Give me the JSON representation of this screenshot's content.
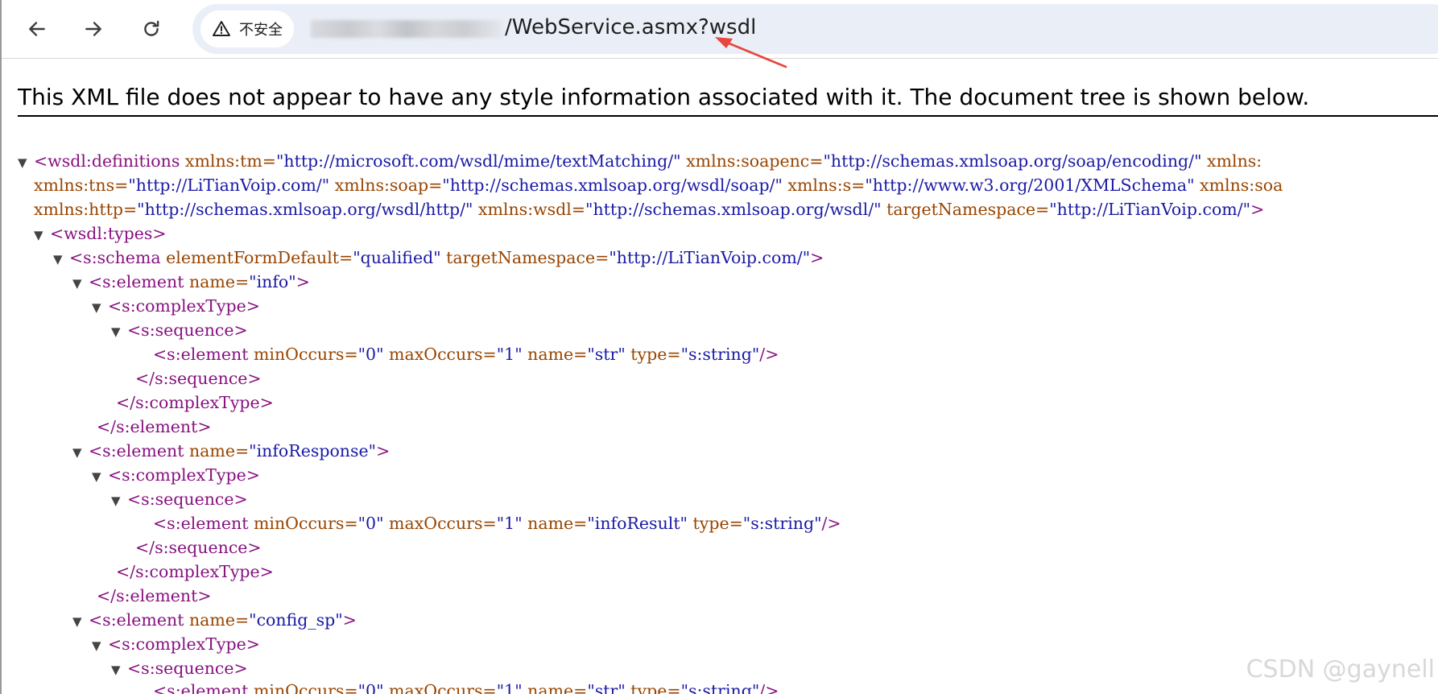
{
  "browser": {
    "security_label": "不安全",
    "url_visible": "/WebService.asmx?wsdl",
    "back_icon": "arrow-left-icon",
    "forward_icon": "arrow-right-icon",
    "reload_icon": "reload-icon",
    "warning_icon": "warning-triangle-icon",
    "arrow_color": "#e8453c"
  },
  "notice": {
    "text": "This XML file does not appear to have any style information associated with it. The document tree is shown below."
  },
  "xml": {
    "l1_tag": "<wsdl:definitions",
    "l1_a1n": " xmlns:tm=",
    "l1_a1v": "\"http://microsoft.com/wsdl/mime/textMatching/\"",
    "l1_a2n": " xmlns:soapenc=",
    "l1_a2v": "\"http://schemas.xmlsoap.org/soap/encoding/\"",
    "l1_a3n": " xmlns:",
    "l2_a1n": "xmlns:tns=",
    "l2_a1v": "\"http://LiTianVoip.com/\"",
    "l2_a2n": " xmlns:soap=",
    "l2_a2v": "\"http://schemas.xmlsoap.org/wsdl/soap/\"",
    "l2_a3n": " xmlns:s=",
    "l2_a3v": "\"http://www.w3.org/2001/XMLSchema\"",
    "l2_a4n": " xmlns:soa",
    "l3_a1n": "xmlns:http=",
    "l3_a1v": "\"http://schemas.xmlsoap.org/wsdl/http/\"",
    "l3_a2n": " xmlns:wsdl=",
    "l3_a2v": "\"http://schemas.xmlsoap.org/wsdl/\"",
    "l3_a3n": " targetNamespace=",
    "l3_a3v": "\"http://LiTianVoip.com/\"",
    "l3_close": ">",
    "l4_tag": "<wsdl:types>",
    "l5_tag": "<s:schema",
    "l5_a1n": " elementFormDefault=",
    "l5_a1v": "\"qualified\"",
    "l5_a2n": " targetNamespace=",
    "l5_a2v": "\"http://LiTianVoip.com/\"",
    "l5_close": ">",
    "el_open": "<s:element",
    "name_attr": " name=",
    "close_gt": ">",
    "ct_open": "<s:complexType>",
    "seq_open": "<s:sequence>",
    "min_attr": " minOccurs=",
    "min_val": "\"0\"",
    "max_attr": " maxOccurs=",
    "max_val": "\"1\"",
    "type_attr": " type=",
    "type_val": "\"s:string\"",
    "self_close": "/>",
    "seq_close": "</s:sequence>",
    "ct_close": "</s:complexType>",
    "el_close": "</s:element>",
    "info_name": "\"info\"",
    "str_name": "\"str\"",
    "infoResponse_name": "\"infoResponse\"",
    "infoResult_name": "\"infoResult\"",
    "config_sp_name": "\"config_sp\""
  },
  "watermark": "CSDN @gaynell"
}
